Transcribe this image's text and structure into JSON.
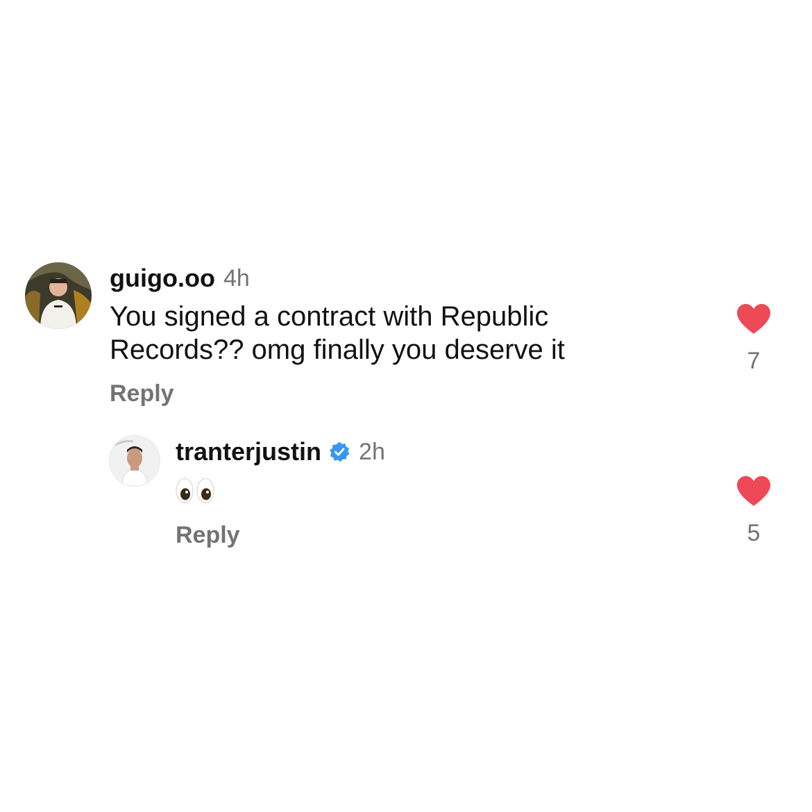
{
  "comments": [
    {
      "username": "guigo.oo",
      "time": "4h",
      "text_line1": "You signed a contract with Republic",
      "text_line2": "Records?? omg finally you deserve it",
      "reply_label": "Reply",
      "likes": "7",
      "liked": true,
      "avatar_icon": "profile-photo"
    }
  ],
  "replies": [
    {
      "username": "tranterjustin",
      "verified": true,
      "time": "2h",
      "text": "👀",
      "reply_label": "Reply",
      "likes": "5",
      "liked": true,
      "avatar_icon": "profile-photo"
    }
  ],
  "colors": {
    "like_red": "#ED4956",
    "verified_blue": "#3897F0",
    "secondary_text": "#737373"
  }
}
